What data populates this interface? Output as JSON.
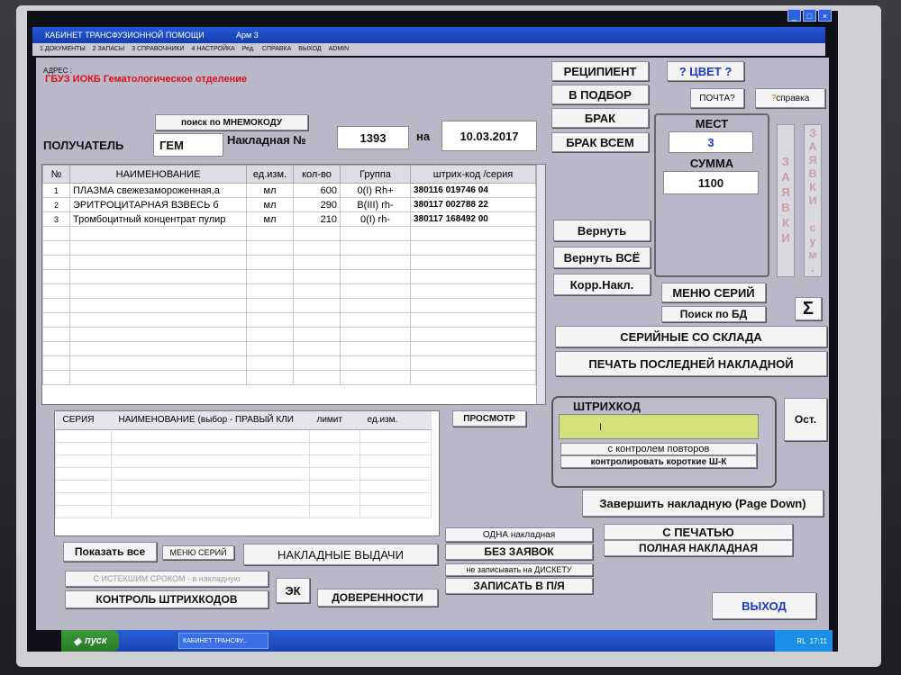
{
  "window": {
    "title": "КАБИНЕТ ТРАНСФУЗИОННОЙ ПОМОЩИ",
    "arm": "Арм 3"
  },
  "menu": [
    "1 ДОКУМЕНТЫ",
    "2 ЗАПАСЫ",
    "3 СПРАВОЧНИКИ",
    "4 НАСТРОЙКА",
    "Ред.",
    "СПРАВКА",
    "ВЫХОД",
    "ADMIN"
  ],
  "header": {
    "address_label": "АДРЕС :",
    "org_name": "ГБУЗ ИОКБ Гематологическое отделение",
    "search_mnemo": "поиск по МНЕМОКОДУ",
    "recipient_label": "ПОЛУЧАТЕЛЬ",
    "recipient_value": "ГЕМ",
    "invoice_label": "Накладная №",
    "invoice_number": "1393",
    "on_label": "на",
    "invoice_date": "10.03.2017"
  },
  "table": {
    "columns": [
      "№",
      "НАИМЕНОВАНИЕ",
      "ед.изм.",
      "кол-во",
      "Группа",
      "штрих-код /серия"
    ],
    "rows": [
      {
        "n": "1",
        "name": "ПЛАЗМА свежезамороженная,а",
        "unit": "мл",
        "qty": "600",
        "group": "0(I)   Rh+",
        "barcode": "380116  019746  04"
      },
      {
        "n": "2",
        "name": "ЭРИТРОЦИТАРНАЯ ВЗВЕСЬ б",
        "unit": "мл",
        "qty": "290",
        "group": "B(III)  rh-",
        "barcode": "380117  002788  22"
      },
      {
        "n": "3",
        "name": "Тромбоцитный концентрат пулир",
        "unit": "мл",
        "qty": "210",
        "group": "0(I)   rh-",
        "barcode": "380117  168492  00"
      }
    ]
  },
  "right": {
    "recipient_btn": "РЕЦИПИЕНТ",
    "color_btn": "? ЦВЕТ ?",
    "to_selection_btn": "В ПОДБОР",
    "mail_btn": "ПОЧТА?",
    "help_btn": "справка",
    "defect_btn": "БРАК",
    "defect_all_btn": "БРАК ВСЕМ",
    "places_label": "МЕСТ",
    "places_value": "3",
    "sum_label": "СУММА",
    "sum_value": "1100",
    "requests_vertical": "ЗАЯВКИ",
    "requests_sum_vertical": "ЗАЯВКИ сум.",
    "return_btn": "Вернуть",
    "return_all_btn": "Вернуть  ВСЁ",
    "corr_btn": "Корр.Накл.",
    "series_menu_btn": "МЕНЮ СЕРИЙ",
    "db_search_btn": "Поиск по БД",
    "sigma_btn": "Σ",
    "serial_stock_btn": "СЕРИЙНЫЕ СО СКЛАДА",
    "print_last_btn": "ПЕЧАТЬ ПОСЛЕДНЕЙ НАКЛАДНОЙ"
  },
  "barcode": {
    "title": "ШТРИХКОД",
    "input_value": "I",
    "repeat_control": "с контролем повторов",
    "short_control": "контролировать короткие Ш-К",
    "ost_btn": "Ост."
  },
  "series_panel": {
    "columns": [
      "СЕРИЯ",
      "НАИМЕНОВАНИЕ (выбор  - ПРАВЫЙ КЛИ",
      "лимит",
      "ед.изм."
    ],
    "view_btn": "ПРОСМОТР"
  },
  "bottom": {
    "show_all_btn": "Показать все",
    "series_menu_small": "МЕНЮ СЕРИЙ",
    "issued_invoices_btn": "НАКЛАДНЫЕ ВЫДАЧИ",
    "expired_btn": "С ИСТЕКШИМ СРОКОМ - в накладную",
    "ek_btn": "ЭК",
    "barcode_control_btn": "КОНТРОЛЬ ШТРИХКОДОВ",
    "powers_btn": "ДОВЕРЕННОСТИ",
    "one_invoice": "ОДНА накладная",
    "no_requests": "БЕЗ ЗАЯВОК",
    "no_disk": "не записывать на ДИСКЕТУ",
    "write_pya": "ЗАПИСАТЬ В П/Я",
    "finish_btn": "Завершить накладную (Page Down)",
    "with_print": "С  ПЕЧАТЬЮ",
    "full_invoice": "ПОЛНАЯ НАКЛАДНАЯ",
    "exit_btn": "ВЫХОД"
  },
  "taskbar": {
    "start": "пуск",
    "task": "КАБИНЕТ ТРАНСФУ...",
    "lang": "RL",
    "time": "17:11"
  }
}
